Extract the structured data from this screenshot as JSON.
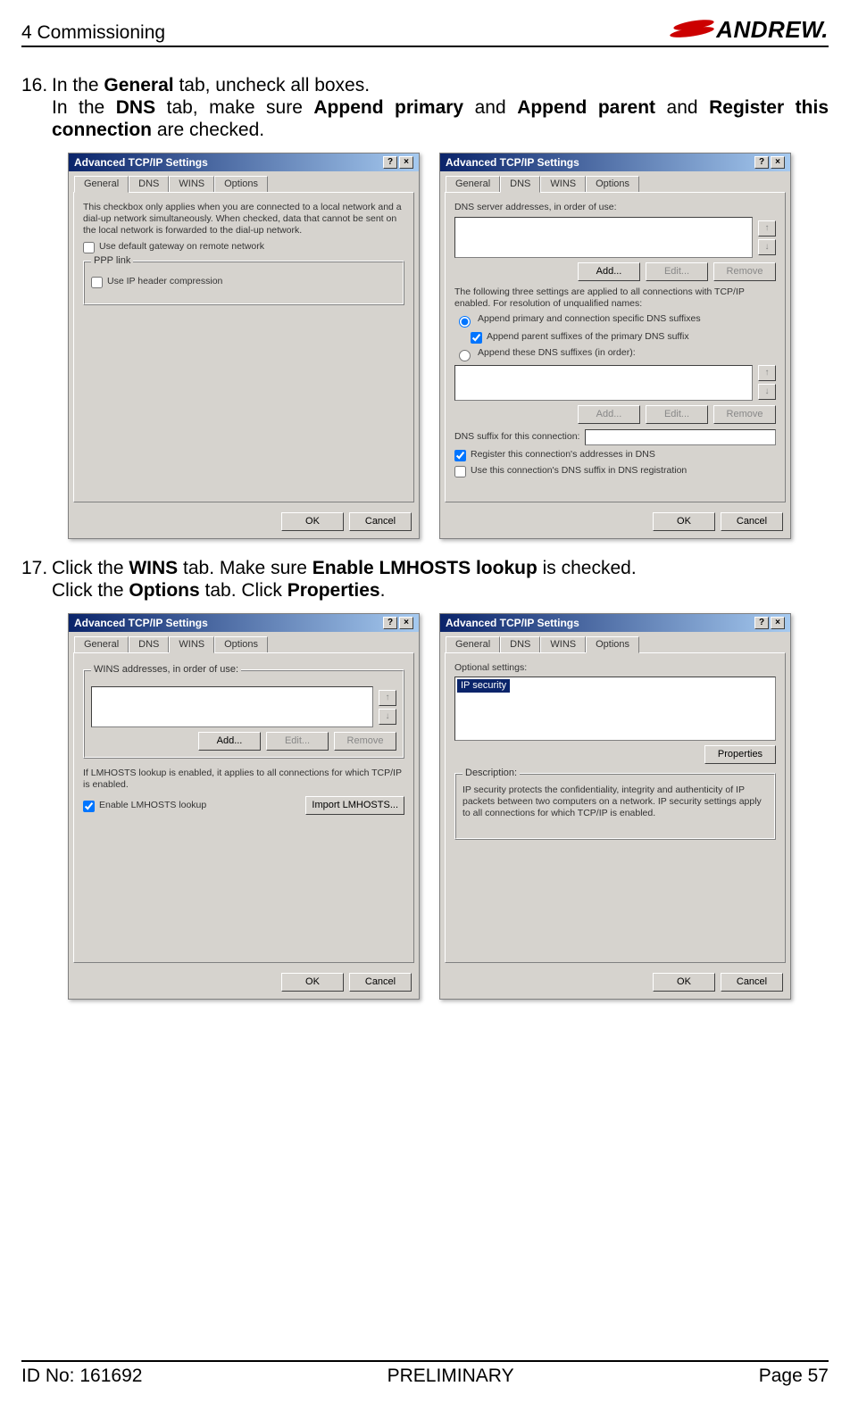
{
  "header": {
    "section": "4 Commissioning",
    "brand": "ANDREW."
  },
  "steps": {
    "s16": {
      "num": "16.",
      "text_plain": "In the ",
      "general": "General",
      "t2": " tab, uncheck all boxes.",
      "line2a": "In the ",
      "dns": "DNS",
      "line2b": " tab, make sure ",
      "ap1": "Append primary",
      "line2c": " and ",
      "ap2": "Append parent",
      "line2d": " and ",
      "ap3": "Register this connection",
      "line2e": " are checked."
    },
    "s17": {
      "num": "17.",
      "l1a": "Click the ",
      "wins": "WINS",
      "l1b": " tab. Make sure ",
      "elm": "Enable LMHOSTS lookup",
      "l1c": " is checked.",
      "l2a": "Click the ",
      "opt": "Options",
      "l2b": " tab. Click ",
      "prop": "Properties",
      "l2c": "."
    }
  },
  "dialog": {
    "title": "Advanced TCP/IP Settings",
    "help": "?",
    "close": "×",
    "tabs": {
      "general": "General",
      "dns": "DNS",
      "wins": "WINS",
      "options": "Options"
    },
    "buttons": {
      "ok": "OK",
      "cancel": "Cancel",
      "add": "Add...",
      "edit": "Edit...",
      "remove": "Remove",
      "properties": "Properties",
      "import": "Import LMHOSTS..."
    },
    "general": {
      "note": "This checkbox only applies when you are connected to a local network and a dial-up network simultaneously. When checked, data that cannot be sent on the local network is forwarded to the dial-up network.",
      "cb1": "Use default gateway on remote network",
      "grp": "PPP link",
      "cb2": "Use IP header compression"
    },
    "dns": {
      "l1": "DNS server addresses, in order of use:",
      "l2": "The following three settings are applied to all connections with TCP/IP enabled. For resolution of unqualified names:",
      "r1": "Append primary and connection specific DNS suffixes",
      "cb1": "Append parent suffixes of the primary DNS suffix",
      "r2": "Append these DNS suffixes (in order):",
      "l3": "DNS suffix for this connection:",
      "cb2": "Register this connection's addresses in DNS",
      "cb3": "Use this connection's DNS suffix in DNS registration"
    },
    "wins": {
      "grp": "WINS addresses, in order of use:",
      "note": "If LMHOSTS lookup is enabled, it applies to all connections for which TCP/IP is enabled.",
      "cb": "Enable LMHOSTS lookup"
    },
    "options": {
      "l1": "Optional settings:",
      "item": "IP security",
      "grp": "Description:",
      "desc": "IP security protects the confidentiality, integrity and authenticity of IP packets between two computers on a network. IP security settings apply to all connections for which TCP/IP is enabled."
    }
  },
  "footer": {
    "id": "ID No: 161692",
    "mid": "PRELIMINARY",
    "page": "Page 57"
  }
}
